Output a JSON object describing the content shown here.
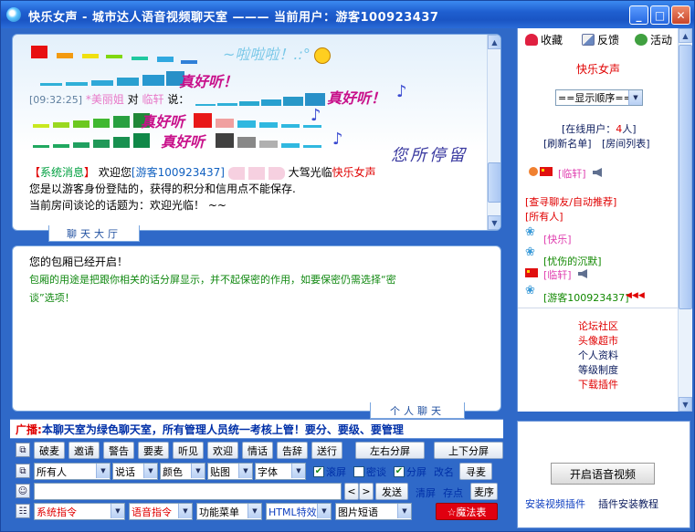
{
  "window": {
    "title": "快乐女声 - 城市达人语音视频聊天室  ———  当前用户：游客100923437"
  },
  "public_chat": {
    "tab_label": "聊天大厅",
    "deco_1": "~啦啦啦！.:°",
    "deco_2": "真好听！",
    "deco_3": "真好听！",
    "deco_4": "真好听",
    "deco_5": "真好听",
    "msg1": {
      "time": "[09:32:25]",
      "from": "*美丽姐",
      "to_word": "对",
      "to": "临轩",
      "say": "说："
    },
    "watermark_text": "您所停留",
    "system": {
      "tag_open": "【",
      "tag": "系统消息",
      "tag_close": "】",
      "welcome": "欢迎您",
      "user": "[游客100923437]",
      "arrive": "大驾光临",
      "room": "快乐女声",
      "line2": "您是以游客身份登陆的，获得的积分和信用点不能保存.",
      "line3": "当前房间谈论的话题为：欢迎光临！ ~~"
    }
  },
  "private_chat": {
    "tab_label": "个人聊天",
    "line1": "您的包厢已经开启！",
    "line2": "包厢的用途是把跟你相关的话分屏显示，并不起保密的作用，如要保密仍需选择“密",
    "line3": "谈”选项！"
  },
  "sidebar": {
    "top_links": [
      "收藏",
      "反馈",
      "活动"
    ],
    "room_name": "快乐女声",
    "order_select": "==显示顺序==",
    "online_prefix": "[在线用户：",
    "online_count": "4",
    "online_suffix": "人]",
    "refresh": "[刷新名单]",
    "room_list": "[房间列表]",
    "user_1": "[临轩]",
    "find_friend": "[查寻聊友/自动推荐]",
    "all": "[所有人]",
    "user_2": "[快乐]",
    "user_3": "[忧伤的沉默]",
    "user_4": "[临轩]",
    "user_5": "[游客100923437]",
    "links": [
      "论坛社区",
      "头像超市",
      "个人资料",
      "等级制度",
      "下载插件"
    ]
  },
  "video_panel": {
    "voice_button": "开启语音视频",
    "video_plugin": "安装视频插件",
    "plugin_tutorial": "插件安装教程"
  },
  "broadcast": {
    "label": "广播:",
    "text": "本聊天室为绿色聊天室，所有管理人员统一考核上管！要分、要级、要管理"
  },
  "toolbar1": [
    "破麦",
    "邀请",
    "警告",
    "要麦",
    "听见",
    "欢迎",
    "情话",
    "告辞",
    "送行",
    "左右分屏",
    "上下分屏"
  ],
  "toolbar2": {
    "target": "所有人",
    "action": "说话",
    "color": "颜色",
    "sticker": "贴图",
    "font": "字体",
    "scroll": "滚屏",
    "secret": "密谈",
    "split": "分屏",
    "rename": "改名",
    "mic": "寻麦"
  },
  "toolbar3": {
    "prev": "<",
    "next": ">",
    "send": "发送",
    "clear": "清屏",
    "save": "存点",
    "mic": "麦序"
  },
  "toolbar4": {
    "system_cmd": "系统指令",
    "voice_cmd": "语音指令",
    "func_menu": "功能菜单",
    "html_fx": "HTML特效",
    "image_short": "图片短语",
    "magic": "☆魔法表"
  },
  "colors": {
    "title_bg": "#1f5fd0",
    "frame": "#2f69c8",
    "accent_red": "#e00000",
    "accent_blue": "#1040c0"
  }
}
